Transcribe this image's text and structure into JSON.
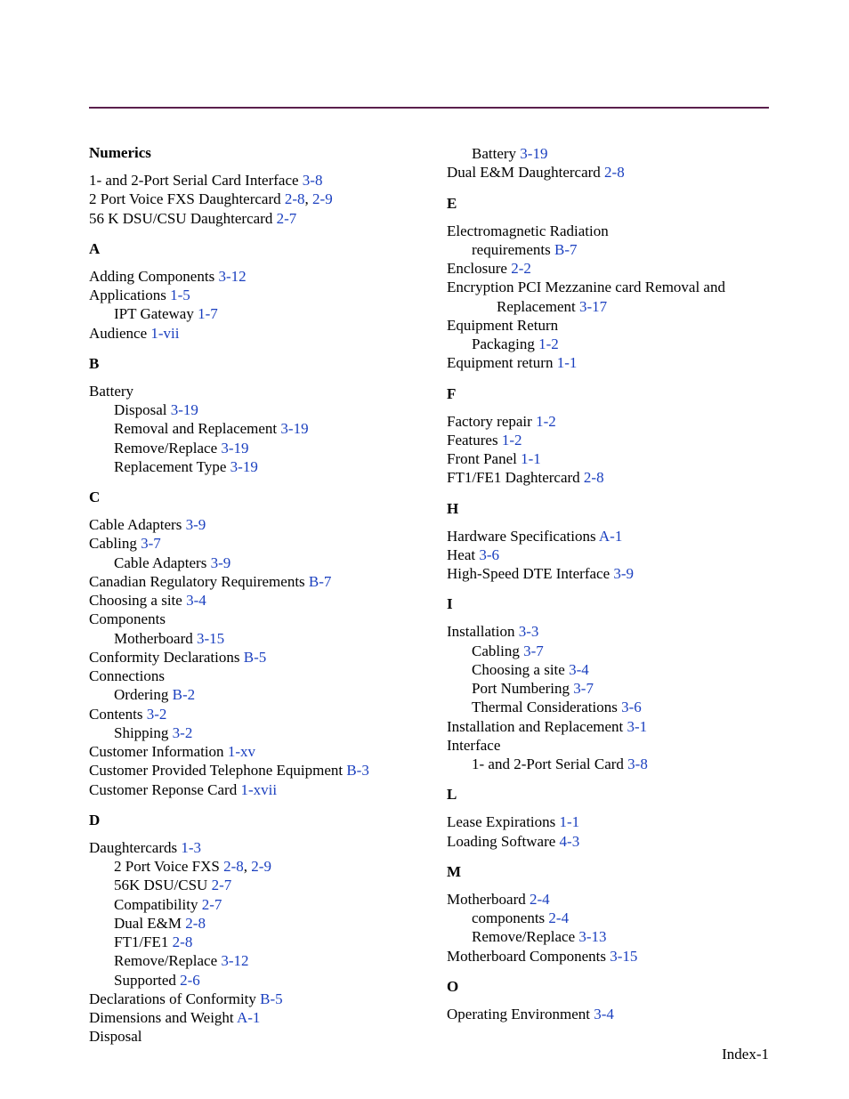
{
  "footer": "Index-1",
  "left": {
    "Numerics": [
      {
        "text": "1- and 2-Port Serial Card Interface",
        "refs": [
          "3-8"
        ]
      },
      {
        "text": "2 Port Voice FXS Daughtercard",
        "refs": [
          "2-8",
          "2-9"
        ]
      },
      {
        "text": "56 K DSU/CSU Daughtercard",
        "refs": [
          "2-7"
        ]
      }
    ],
    "A": [
      {
        "text": "Adding Components",
        "refs": [
          "3-12"
        ]
      },
      {
        "text": "Applications",
        "refs": [
          "1-5"
        ]
      },
      {
        "text": "IPT Gateway",
        "refs": [
          "1-7"
        ],
        "sub": true
      },
      {
        "text": "Audience",
        "refs": [
          "1-vii"
        ]
      }
    ],
    "B": [
      {
        "text": "Battery",
        "refs": []
      },
      {
        "text": "Disposal",
        "refs": [
          "3-19"
        ],
        "sub": true
      },
      {
        "text": "Removal and Replacement",
        "refs": [
          "3-19"
        ],
        "sub": true
      },
      {
        "text": "Remove/Replace",
        "refs": [
          "3-19"
        ],
        "sub": true
      },
      {
        "text": "Replacement Type",
        "refs": [
          "3-19"
        ],
        "sub": true
      }
    ],
    "C": [
      {
        "text": "Cable Adapters",
        "refs": [
          "3-9"
        ]
      },
      {
        "text": "Cabling",
        "refs": [
          "3-7"
        ]
      },
      {
        "text": "Cable Adapters",
        "refs": [
          "3-9"
        ],
        "sub": true
      },
      {
        "text": "Canadian Regulatory Requirements",
        "refs": [
          "B-7"
        ]
      },
      {
        "text": "Choosing a site",
        "refs": [
          "3-4"
        ]
      },
      {
        "text": "Components",
        "refs": []
      },
      {
        "text": "Motherboard",
        "refs": [
          "3-15"
        ],
        "sub": true
      },
      {
        "text": "Conformity Declarations",
        "refs": [
          "B-5"
        ]
      },
      {
        "text": "Connections",
        "refs": []
      },
      {
        "text": "Ordering",
        "refs": [
          "B-2"
        ],
        "sub": true
      },
      {
        "text": "Contents",
        "refs": [
          "3-2"
        ]
      },
      {
        "text": "Shipping",
        "refs": [
          "3-2"
        ],
        "sub": true
      },
      {
        "text": "Customer Information",
        "refs": [
          "1-xv"
        ]
      },
      {
        "text": "Customer Provided Telephone Equipment",
        "refs": [
          "B-3"
        ]
      },
      {
        "text": "Customer Reponse Card",
        "refs": [
          "1-xvii"
        ]
      }
    ],
    "D": [
      {
        "text": "Daughtercards",
        "refs": [
          "1-3"
        ]
      },
      {
        "text": "2 Port Voice FXS",
        "refs": [
          "2-8",
          "2-9"
        ],
        "sub": true
      },
      {
        "text": "56K DSU/CSU",
        "refs": [
          "2-7"
        ],
        "sub": true
      },
      {
        "text": "Compatibility",
        "refs": [
          "2-7"
        ],
        "sub": true
      },
      {
        "text": "Dual E&M",
        "refs": [
          "2-8"
        ],
        "sub": true
      },
      {
        "text": "FT1/FE1",
        "refs": [
          "2-8"
        ],
        "sub": true
      },
      {
        "text": "Remove/Replace",
        "refs": [
          "3-12"
        ],
        "sub": true
      },
      {
        "text": "Supported",
        "refs": [
          "2-6"
        ],
        "sub": true
      },
      {
        "text": "Declarations of Conformity",
        "refs": [
          "B-5"
        ]
      },
      {
        "text": "Dimensions and Weight",
        "refs": [
          "A-1"
        ]
      },
      {
        "text": "Disposal",
        "refs": []
      }
    ]
  },
  "right": {
    "_cont": [
      {
        "text": "Battery",
        "refs": [
          "3-19"
        ],
        "sub": true
      },
      {
        "text": "Dual E&M Daughtercard",
        "refs": [
          "2-8"
        ]
      }
    ],
    "E": [
      {
        "text": "Electromagnetic Radiation",
        "refs": []
      },
      {
        "text": "requirements",
        "refs": [
          "B-7"
        ],
        "sub": true
      },
      {
        "text": "Enclosure",
        "refs": [
          "2-2"
        ]
      },
      {
        "text": "Encryption PCI Mezzanine card Removal and",
        "refs": []
      },
      {
        "text": "Replacement",
        "refs": [
          "3-17"
        ],
        "sub": true,
        "subsub": true
      },
      {
        "text": "Equipment Return",
        "refs": []
      },
      {
        "text": "Packaging",
        "refs": [
          "1-2"
        ],
        "sub": true
      },
      {
        "text": "Equipment return",
        "refs": [
          "1-1"
        ]
      }
    ],
    "F": [
      {
        "text": "Factory repair",
        "refs": [
          "1-2"
        ]
      },
      {
        "text": "Features",
        "refs": [
          "1-2"
        ]
      },
      {
        "text": "Front Panel",
        "refs": [
          "1-1"
        ]
      },
      {
        "text": "FT1/FE1 Daghtercard",
        "refs": [
          "2-8"
        ]
      }
    ],
    "H": [
      {
        "text": "Hardware Specifications",
        "refs": [
          "A-1"
        ]
      },
      {
        "text": "Heat",
        "refs": [
          "3-6"
        ]
      },
      {
        "text": "High-Speed DTE Interface",
        "refs": [
          "3-9"
        ]
      }
    ],
    "I": [
      {
        "text": "Installation",
        "refs": [
          "3-3"
        ]
      },
      {
        "text": "Cabling",
        "refs": [
          "3-7"
        ],
        "sub": true
      },
      {
        "text": "Choosing a site",
        "refs": [
          "3-4"
        ],
        "sub": true
      },
      {
        "text": "Port Numbering",
        "refs": [
          "3-7"
        ],
        "sub": true
      },
      {
        "text": "Thermal Considerations",
        "refs": [
          "3-6"
        ],
        "sub": true
      },
      {
        "text": "Installation and Replacement",
        "refs": [
          "3-1"
        ]
      },
      {
        "text": "Interface",
        "refs": []
      },
      {
        "text": "1- and 2-Port Serial Card",
        "refs": [
          "3-8"
        ],
        "sub": true
      }
    ],
    "L": [
      {
        "text": "Lease Expirations",
        "refs": [
          "1-1"
        ]
      },
      {
        "text": "Loading Software",
        "refs": [
          "4-3"
        ]
      }
    ],
    "M": [
      {
        "text": "Motherboard",
        "refs": [
          "2-4"
        ]
      },
      {
        "text": "components",
        "refs": [
          "2-4"
        ],
        "sub": true
      },
      {
        "text": "Remove/Replace",
        "refs": [
          "3-13"
        ],
        "sub": true
      },
      {
        "text": "Motherboard Components",
        "refs": [
          "3-15"
        ]
      }
    ],
    "O": [
      {
        "text": "Operating Environment",
        "refs": [
          "3-4"
        ]
      }
    ]
  }
}
